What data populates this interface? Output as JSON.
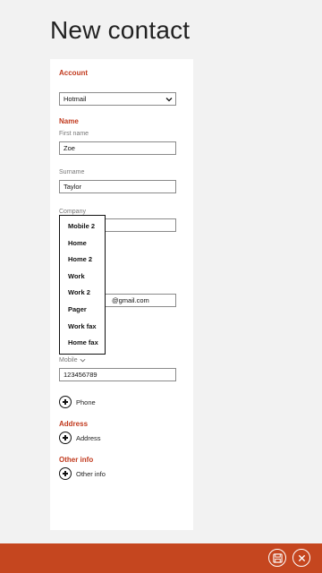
{
  "page": {
    "title": "New contact"
  },
  "form": {
    "account": {
      "section": "Account",
      "value": "Hotmail"
    },
    "name": {
      "section": "Name",
      "first_name_label": "First name",
      "first_name": "Zoe",
      "surname_label": "Surname",
      "surname": "Taylor",
      "company_label": "Company",
      "company": ""
    },
    "email": {
      "value_visible": "@gmail.com"
    },
    "phone": {
      "type_label": "Mobile",
      "value": "123456789",
      "add_label": "Phone"
    },
    "address": {
      "section": "Address",
      "add_label": "Address"
    },
    "other": {
      "section": "Other info",
      "add_label": "Other info"
    }
  },
  "phone_type_menu": {
    "options": [
      "Mobile 2",
      "Home",
      "Home 2",
      "Work",
      "Work 2",
      "Pager",
      "Work fax",
      "Home fax"
    ]
  },
  "app_bar": {
    "icons": [
      "save-icon",
      "cancel-icon"
    ],
    "color": "#c5461f"
  },
  "colors": {
    "accent": "#c1391d",
    "panel": "#ffffff",
    "background": "#f2f2f2"
  }
}
